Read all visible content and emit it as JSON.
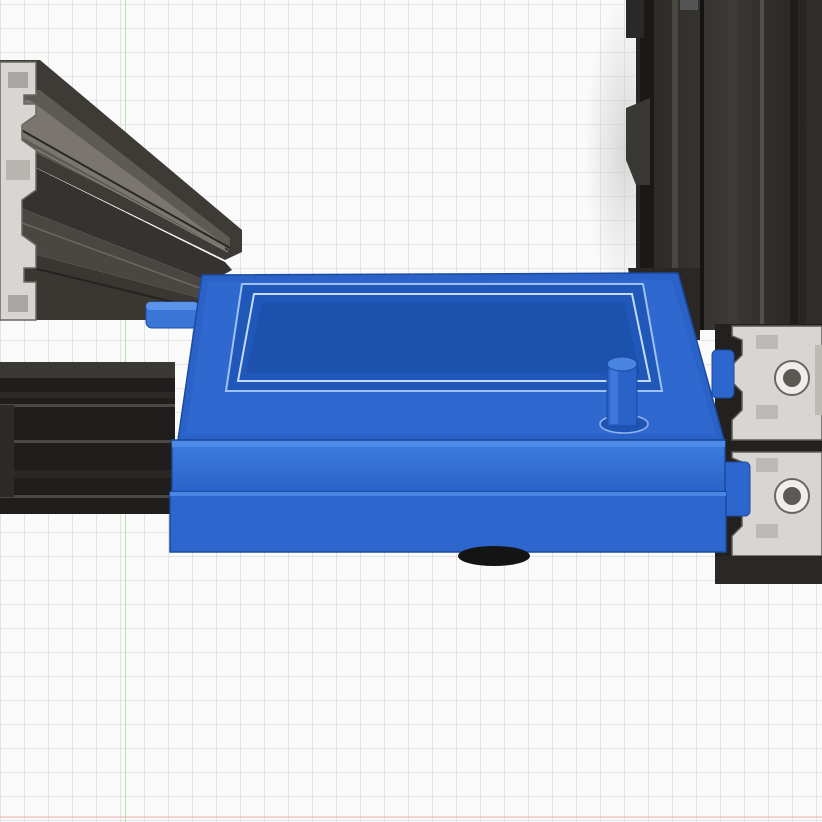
{
  "app": {
    "view": "3D model canvas",
    "grid": true
  },
  "model": {
    "enclosure_color": "#2f6fd6",
    "screen_color": "#1f58b8",
    "frame_color": "#3d3a36",
    "rail_dark_color": "#1f1e1c",
    "profile_face_color": "#d8d6d2"
  },
  "icons": [
    "extrusion-profile-icon",
    "knob-icon"
  ]
}
